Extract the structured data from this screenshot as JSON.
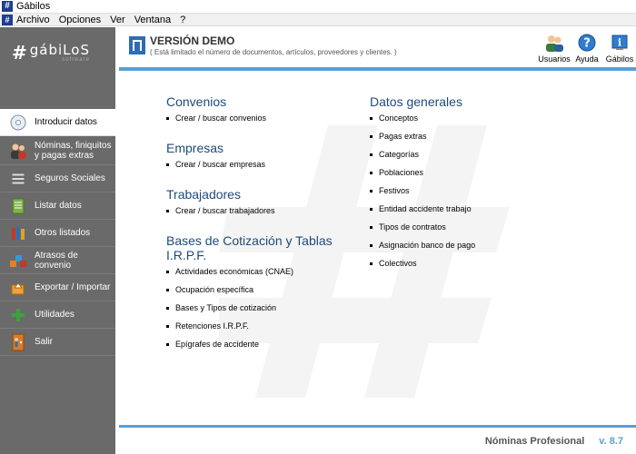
{
  "window": {
    "title": "Gábilos"
  },
  "menu": [
    "Archivo",
    "Opciones",
    "Ver",
    "Ventana",
    "?"
  ],
  "logo": {
    "main": "gábiLoS",
    "sub": "software"
  },
  "sidebar": {
    "items": [
      {
        "label": "Introducir datos",
        "icon": "disc-icon",
        "active": true
      },
      {
        "label": "Nóminas, finiquitos y pagas extras",
        "icon": "people-icon"
      },
      {
        "label": "Seguros Sociales",
        "icon": "stack-icon"
      },
      {
        "label": "Listar datos",
        "icon": "list-icon"
      },
      {
        "label": "Otros listados",
        "icon": "books-icon"
      },
      {
        "label": "Atrasos de convenio",
        "icon": "blocks-icon"
      },
      {
        "label": "Exportar / Importar",
        "icon": "export-icon"
      },
      {
        "label": "Utilidades",
        "icon": "plus-icon"
      },
      {
        "label": "Salir",
        "icon": "exit-icon"
      }
    ]
  },
  "header": {
    "title": "VERSIÓN DEMO",
    "subtitle": "( Está limitado el número de documentos, artículos, proveedores y clientes. )",
    "tools": [
      {
        "label": "Usuarios",
        "icon": "users-icon"
      },
      {
        "label": "Ayuda",
        "icon": "help-icon"
      },
      {
        "label": "Gábilos",
        "icon": "info-icon"
      }
    ]
  },
  "sections_left": [
    {
      "title": "Convenios",
      "items": [
        "Crear / buscar convenios"
      ]
    },
    {
      "title": "Empresas",
      "items": [
        "Crear / buscar empresas"
      ]
    },
    {
      "title": "Trabajadores",
      "items": [
        "Crear / buscar trabajadores"
      ]
    },
    {
      "title": "Bases de Cotización y Tablas I.R.P.F.",
      "items": [
        "Actividades económicas (CNAE)",
        "Ocupación específica",
        "Bases y Tipos de cotización",
        "Retenciones I.R.P.F.",
        "Epígrafes de accidente"
      ]
    }
  ],
  "sections_right": [
    {
      "title": "Datos generales",
      "items": [
        "Conceptos",
        "Pagas extras",
        "Categorías",
        "Poblaciones",
        "Festivos",
        "Entidad accidente trabajo",
        "Tipos de contratos",
        "Asignación banco de pago",
        "Colectivos"
      ]
    }
  ],
  "footer": {
    "product": "Nóminas Profesional",
    "version": "v. 8.7"
  },
  "colors": {
    "accent": "#5a9fd6",
    "sidebar": "#6a6a6a",
    "heading": "#1d4b7a"
  }
}
